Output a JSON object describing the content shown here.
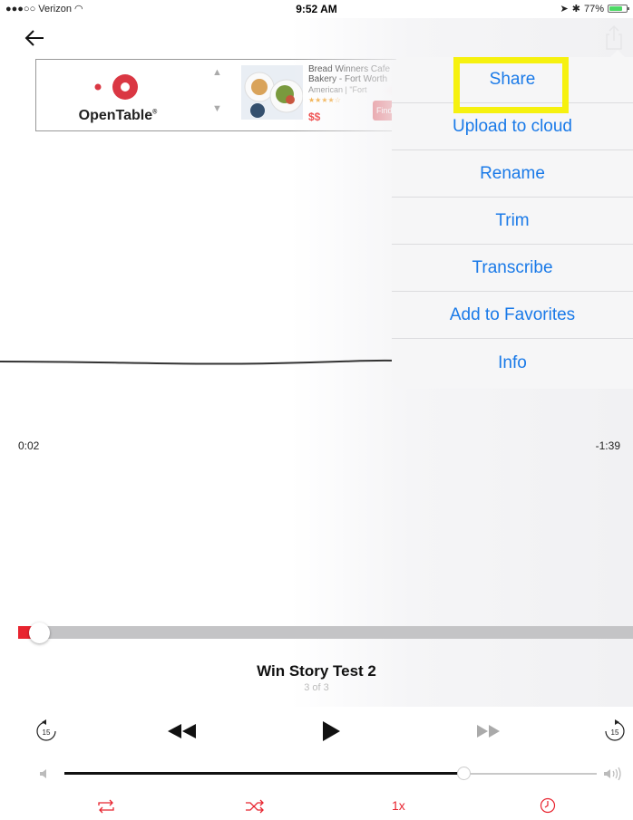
{
  "status_bar": {
    "carrier": "●●●○○ Verizon",
    "time": "9:52 AM",
    "battery_percent": "77%",
    "battery_level": 0.77,
    "icons": [
      "wifi-icon",
      "location-icon",
      "bluetooth-icon",
      "battery-icon"
    ]
  },
  "nav": {
    "back_icon": "back-arrow-icon",
    "share_icon": "share-icon"
  },
  "ad": {
    "brand": "OpenTable",
    "restaurant": "Bread Winners Cafe Bakery - Fort Worth",
    "category": "American | \"Fort",
    "price": "$$",
    "cta": "Find"
  },
  "menu": {
    "items": [
      {
        "label": "Share"
      },
      {
        "label": "Upload to cloud"
      },
      {
        "label": "Rename"
      },
      {
        "label": "Trim"
      },
      {
        "label": "Transcribe"
      },
      {
        "label": "Add to Favorites"
      },
      {
        "label": "Info"
      }
    ],
    "highlighted": "Share"
  },
  "player": {
    "elapsed": "0:02",
    "remaining": "-1:39",
    "progress": 0.02,
    "title": "Win Story Test 2",
    "position": "3 of 3",
    "skip_back_seconds": "15",
    "skip_forward_seconds": "15",
    "volume": 0.75,
    "speed": "1x"
  },
  "colors": {
    "accent": "#e8242f",
    "menu_text": "#1a7ae8",
    "highlight_box": "#f6f10f",
    "opentable_red": "#da3743"
  }
}
